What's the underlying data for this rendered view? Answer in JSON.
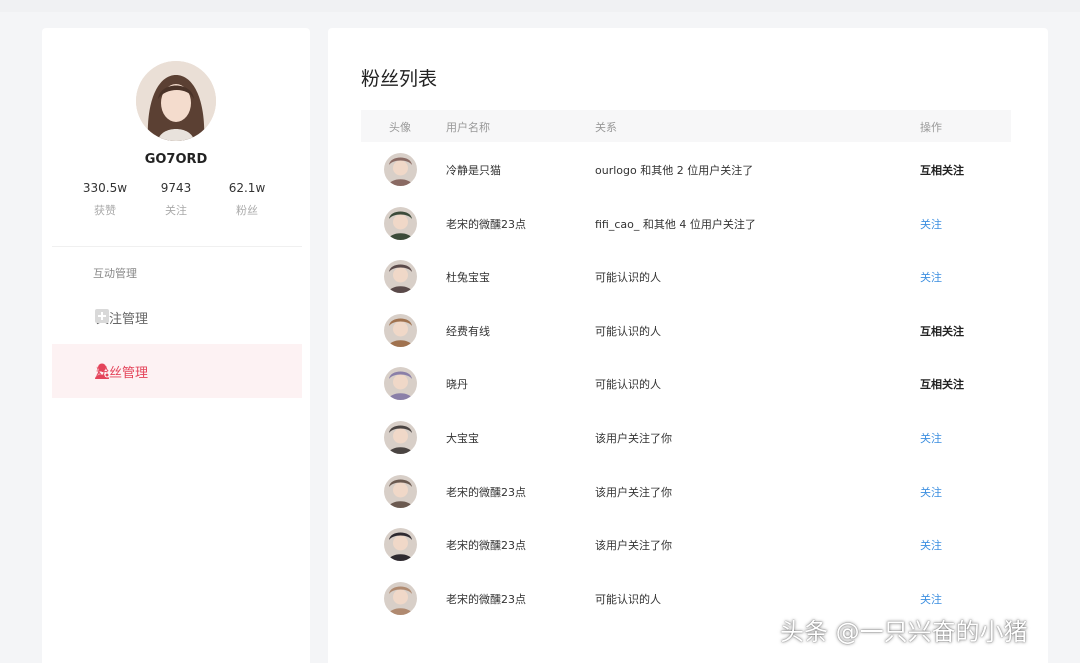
{
  "profile": {
    "username": "GO7ORD",
    "stats": [
      {
        "value": "330.5w",
        "label": "获赞"
      },
      {
        "value": "9743",
        "label": "关注"
      },
      {
        "value": "62.1w",
        "label": "粉丝"
      }
    ]
  },
  "sidebar": {
    "group_label": "互动管理",
    "items": [
      {
        "label": "关注管理",
        "icon": "plus-square-icon",
        "active": false
      },
      {
        "label": "粉丝管理",
        "icon": "user-icon",
        "active": true
      }
    ]
  },
  "main": {
    "title": "粉丝列表",
    "columns": [
      "头像",
      "用户名称",
      "关系",
      "操作"
    ],
    "rows": [
      {
        "name": "冷静是只猫",
        "relation": "ourlogo 和其他 2 位用户关注了",
        "action": "互相关注",
        "action_type": "mutual",
        "avatar_color": "#8a6a63"
      },
      {
        "name": "老宋的微醺23点",
        "relation": "fifi_cao_ 和其他 4 位用户关注了",
        "action": "关注",
        "action_type": "follow",
        "avatar_color": "#3c4b3a"
      },
      {
        "name": "杜兔宝宝",
        "relation": "可能认识的人",
        "action": "关注",
        "action_type": "follow",
        "avatar_color": "#5a4a4a"
      },
      {
        "name": "经费有线",
        "relation": "可能认识的人",
        "action": "互相关注",
        "action_type": "mutual",
        "avatar_color": "#a0724f"
      },
      {
        "name": "晓丹",
        "relation": "可能认识的人",
        "action": "互相关注",
        "action_type": "mutual",
        "avatar_color": "#8a7fa8"
      },
      {
        "name": "大宝宝",
        "relation": "该用户关注了你",
        "action": "关注",
        "action_type": "follow",
        "avatar_color": "#4a4442"
      },
      {
        "name": "老宋的微醺23点",
        "relation": "该用户关注了你",
        "action": "关注",
        "action_type": "follow",
        "avatar_color": "#6b5a50"
      },
      {
        "name": "老宋的微醺23点",
        "relation": "该用户关注了你",
        "action": "关注",
        "action_type": "follow",
        "avatar_color": "#2e2a30"
      },
      {
        "name": "老宋的微醺23点",
        "relation": "可能认识的人",
        "action": "关注",
        "action_type": "follow",
        "avatar_color": "#b08a70"
      }
    ]
  },
  "watermark": "头条 @一只兴奋的小猪",
  "colors": {
    "accent": "#e4445a",
    "link": "#3d8fe0",
    "active_bg": "#fdf2f3"
  }
}
